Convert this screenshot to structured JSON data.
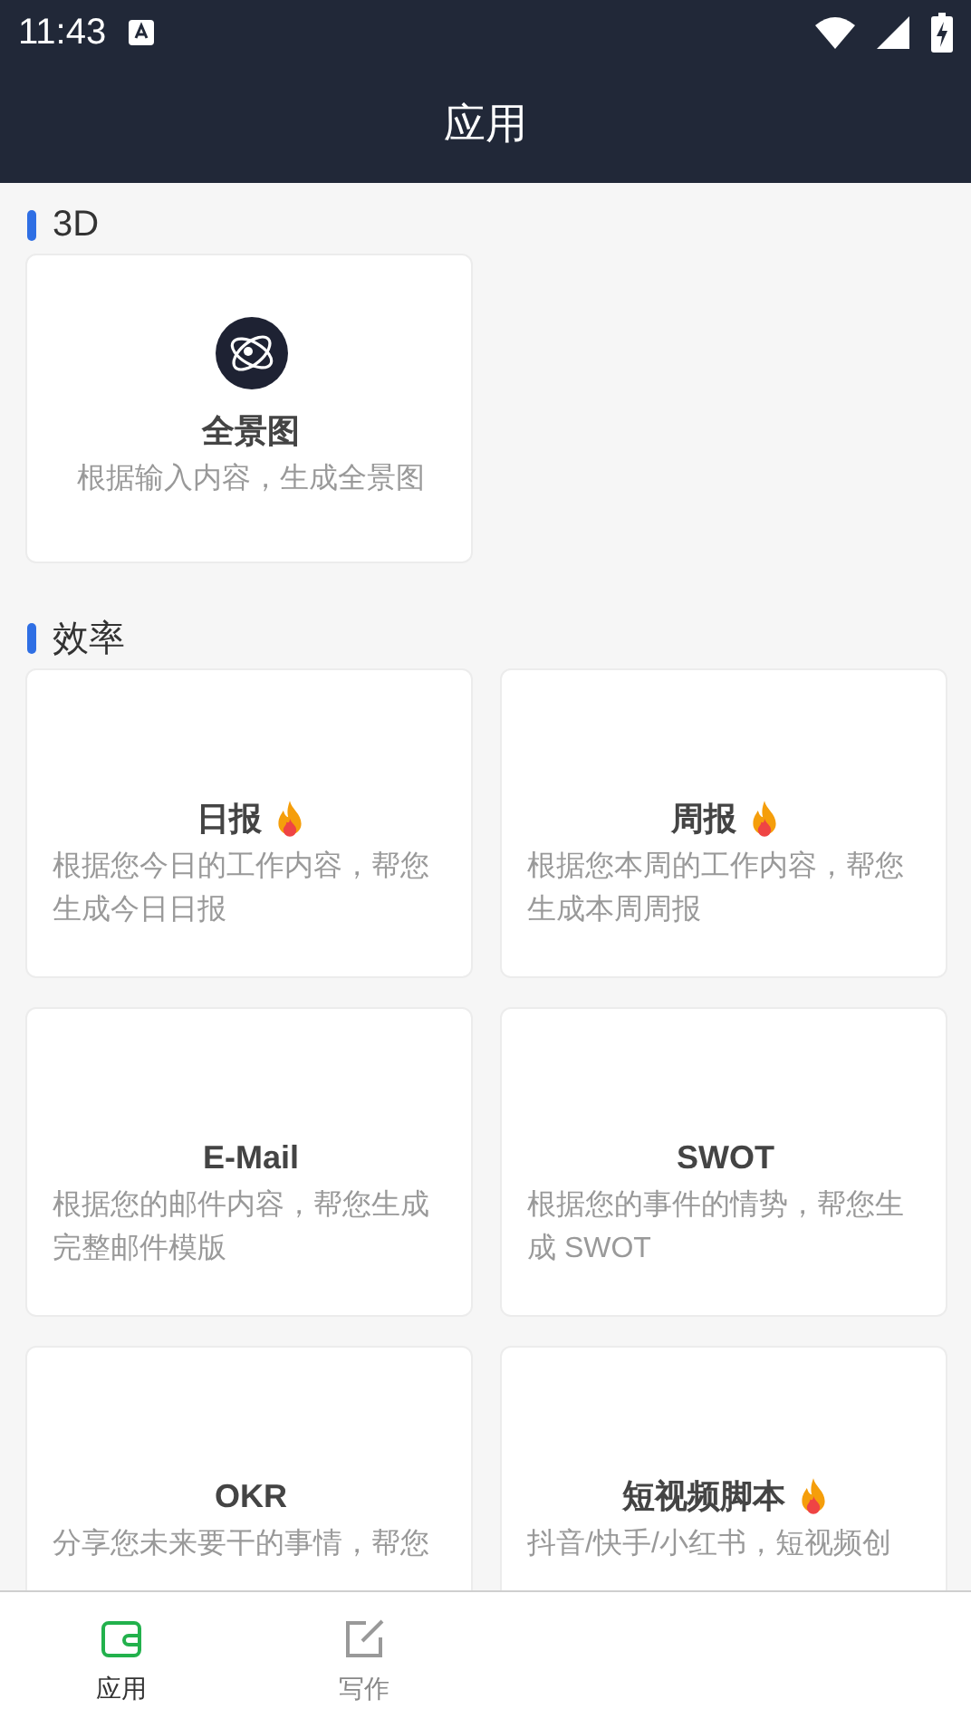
{
  "status_bar": {
    "time": "11:43"
  },
  "header": {
    "title": "应用"
  },
  "sections": [
    {
      "title": "3D",
      "cards": [
        {
          "kind": "icon-card",
          "title": "全景图",
          "hot": false,
          "description": "根据输入内容，生成全景图"
        }
      ]
    },
    {
      "title": "效率",
      "cards": [
        {
          "kind": "text-card",
          "title": "日报",
          "hot": true,
          "description": "根据您今日的工作内容，帮您生成今日日报"
        },
        {
          "kind": "text-card",
          "title": "周报",
          "hot": true,
          "description": "根据您本周的工作内容，帮您生成本周周报"
        },
        {
          "kind": "text-card",
          "title": "E-Mail",
          "hot": false,
          "description": "根据您的邮件内容，帮您生成完整邮件模版"
        },
        {
          "kind": "text-card",
          "title": "SWOT",
          "hot": false,
          "description": "根据您的事件的情势，帮您生成 SWOT"
        },
        {
          "kind": "text-card",
          "title": "OKR",
          "hot": false,
          "description": "分享您未来要干的事情，帮您"
        },
        {
          "kind": "text-card",
          "title": "短视频脚本",
          "hot": true,
          "description": "抖音/快手/小红书，短视频创"
        }
      ]
    }
  ],
  "tabs": [
    {
      "label": "应用",
      "selected": true
    },
    {
      "label": "写作",
      "selected": false
    }
  ]
}
